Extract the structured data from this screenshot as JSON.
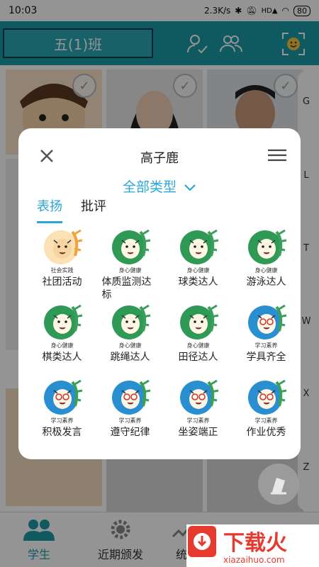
{
  "status_bar": {
    "time": "10:03",
    "net_speed": "2.3K/s",
    "signal": "HD",
    "battery": "80"
  },
  "header": {
    "class_name": "五(1)班"
  },
  "index_letters": [
    "G",
    "L",
    "T",
    "W",
    "X",
    "Z"
  ],
  "dialog": {
    "student_name": "高子鹿",
    "type_filter": "全部类型",
    "tabs": [
      {
        "label": "表扬",
        "active": true
      },
      {
        "label": "批评",
        "active": false
      }
    ],
    "items": [
      {
        "category": "社会实践",
        "label": "社团活动",
        "theme": "orange"
      },
      {
        "category": "身心健康",
        "label": "体质监测达标",
        "theme": "green"
      },
      {
        "category": "身心健康",
        "label": "球类达人",
        "theme": "green"
      },
      {
        "category": "身心健康",
        "label": "游泳达人",
        "theme": "green"
      },
      {
        "category": "身心健康",
        "label": "棋类达人",
        "theme": "green"
      },
      {
        "category": "身心健康",
        "label": "跳绳达人",
        "theme": "green"
      },
      {
        "category": "身心健康",
        "label": "田径达人",
        "theme": "green"
      },
      {
        "category": "学习素养",
        "label": "学具齐全",
        "theme": "blue"
      },
      {
        "category": "学习素养",
        "label": "积极发言",
        "theme": "blue"
      },
      {
        "category": "学习素养",
        "label": "遵守纪律",
        "theme": "blue"
      },
      {
        "category": "学习素养",
        "label": "坐姿端正",
        "theme": "blue"
      },
      {
        "category": "学习素养",
        "label": "作业优秀",
        "theme": "blue"
      }
    ]
  },
  "bottom_nav": [
    {
      "label": "学生",
      "icon": "students-icon",
      "active": true
    },
    {
      "label": "近期颁发",
      "icon": "gear-icon",
      "active": false
    },
    {
      "label": "统",
      "icon": "stats-icon",
      "active": false
    }
  ],
  "watermark": {
    "text": "下载火",
    "url_text": "xiazaihuo.com"
  },
  "colors": {
    "accent": "#1a9ba8",
    "tab_blue": "#2aa7d8",
    "green": "#3aa05a",
    "orange": "#f2a23a",
    "blue": "#2a8fd0"
  }
}
